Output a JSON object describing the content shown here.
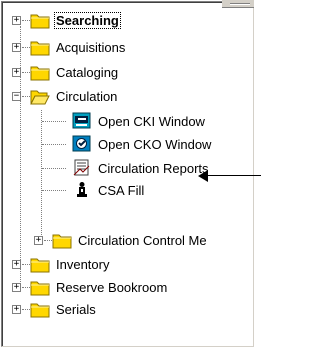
{
  "tree": {
    "items": [
      {
        "label": "Searching",
        "icon": "folder-closed-icon",
        "expander": "+",
        "selected": true
      },
      {
        "label": "Acquisitions",
        "icon": "folder-closed-icon",
        "expander": "+"
      },
      {
        "label": "Cataloging",
        "icon": "folder-closed-icon",
        "expander": "+"
      },
      {
        "label": "Circulation",
        "icon": "folder-open-icon",
        "expander": "−"
      },
      {
        "label": "Open CKI Window",
        "icon": "cki-window-icon"
      },
      {
        "label": "Open CKO Window",
        "icon": "cko-window-icon"
      },
      {
        "label": "Circulation Reports",
        "icon": "reports-icon"
      },
      {
        "label": "CSA Fill",
        "icon": "csa-fill-icon"
      },
      {
        "label": "Circulation Control Me",
        "icon": "folder-closed-icon",
        "expander": "+"
      },
      {
        "label": "Inventory",
        "icon": "folder-closed-icon",
        "expander": "+"
      },
      {
        "label": "Reserve Bookroom",
        "icon": "folder-closed-icon",
        "expander": "+"
      },
      {
        "label": "Serials",
        "icon": "folder-closed-icon",
        "expander": "+"
      }
    ]
  },
  "colors": {
    "folder": "#ffd700",
    "folder_dark": "#8b7300",
    "line": "#808080"
  }
}
